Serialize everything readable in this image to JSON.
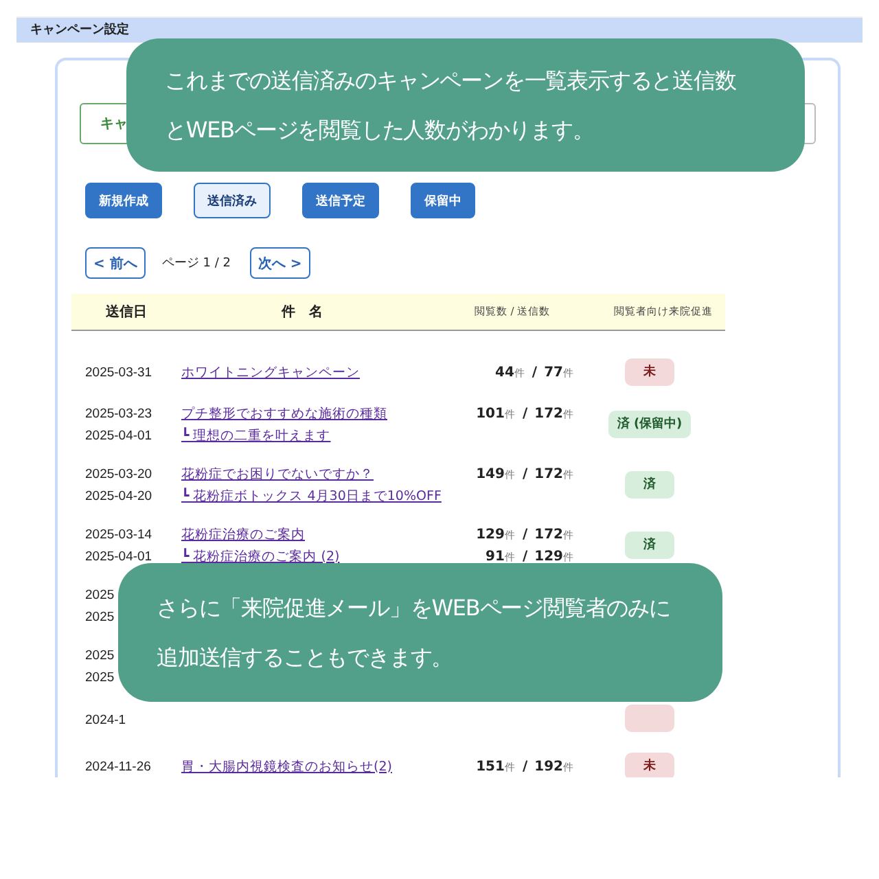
{
  "header": {
    "title": "キャンペーン設定"
  },
  "tabs": [
    {
      "label": "キャ",
      "selected": true
    },
    {
      "selected": false
    }
  ],
  "actions": [
    {
      "label": "新規作成",
      "selected": false
    },
    {
      "label": "送信済み",
      "selected": true
    },
    {
      "label": "送信予定",
      "selected": false
    },
    {
      "label": "保留中",
      "selected": false
    }
  ],
  "pager": {
    "prev": "< 前へ",
    "info": "ページ 1 / 2",
    "next": "次へ >"
  },
  "table": {
    "columns": [
      "送信日",
      "件　名",
      "閲覧数 / 送信数",
      "閲覧者向け来院促進"
    ],
    "rows": [
      {
        "lines": [
          {
            "date": "2025-03-31",
            "subject": "ホワイトニングキャンペーン",
            "views": "44",
            "views_unit": "件",
            "sep": "/",
            "sent": "77",
            "sent_unit": "件"
          }
        ],
        "status": {
          "kind": "pending",
          "label": "未"
        }
      },
      {
        "lines": [
          {
            "date": "2025-03-23",
            "subject": "プチ整形でおすすめな施術の種類",
            "views": "101",
            "views_unit": "件",
            "sep": "/",
            "sent": "172",
            "sent_unit": "件"
          },
          {
            "date": "2025-04-01",
            "subject": "┗ 理想の二重を叶えます"
          }
        ],
        "status": {
          "kind": "done",
          "label": "済 (保留中)"
        }
      },
      {
        "lines": [
          {
            "date": "2025-03-20",
            "subject": "花粉症でお困りでないですか？",
            "views": "149",
            "views_unit": "件",
            "sep": "/",
            "sent": "172",
            "sent_unit": "件"
          },
          {
            "date": "2025-04-20",
            "subject": "┗ 花粉症ボトックス 4月30日まで10%OFF"
          }
        ],
        "status": {
          "kind": "done",
          "label": "済"
        }
      },
      {
        "lines": [
          {
            "date": "2025-03-14",
            "subject": "花粉症治療のご案内",
            "views": "129",
            "views_unit": "件",
            "sep": "/",
            "sent": "172",
            "sent_unit": "件"
          },
          {
            "date": "2025-04-01",
            "subject": "┗ 花粉症治療のご案内 (2)",
            "views": "91",
            "views_unit": "件",
            "sep": "/",
            "sent": "129",
            "sent_unit": "件"
          }
        ],
        "status": {
          "kind": "done",
          "label": "済"
        }
      },
      {
        "lines": [
          {
            "date": "2025"
          },
          {
            "date": "2025"
          }
        ]
      },
      {
        "lines": [
          {
            "date": "2025"
          },
          {
            "date": "2025"
          }
        ]
      },
      {
        "lines": [
          {
            "date": "2024-1"
          }
        ],
        "status": {
          "kind": "pending"
        }
      },
      {
        "lines": [
          {
            "date": "2024-11-26",
            "subject": "胃・大腸内視鏡検査のお知らせ(2)",
            "views": "151",
            "views_unit": "件",
            "sep": "/",
            "sent": "192",
            "sent_unit": "件"
          }
        ],
        "status": {
          "kind": "pending",
          "label": "未"
        }
      }
    ]
  },
  "callouts": [
    {
      "text": "これまでの送信済みのキャンペーンを一覧表示すると送信数とWEBページを閲覧した人数がわかります。"
    },
    {
      "text": "さらに「来院促進メール」をWEBページ閲覧者のみに追加送信することもできます。"
    }
  ]
}
